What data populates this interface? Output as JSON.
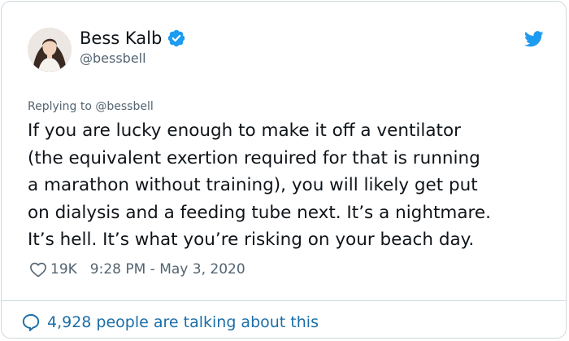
{
  "author": {
    "display_name": "Bess Kalb",
    "handle": "@bessbell",
    "verified": true,
    "avatar_icon": "profile-photo"
  },
  "tweet": {
    "reply_label": "Replying to @bessbell",
    "text_lines": [
      "If you are lucky enough to make it off a ventilator",
      "(the equivalent exertion required for that is running",
      "a marathon without training), you will likely get put",
      "on dialysis and a feeding tube next. It’s a nightmare.",
      "It’s hell. It’s what you’re risking on your beach day."
    ],
    "likes": "19K",
    "timestamp": "9:28 PM - May 3, 2020"
  },
  "footer": {
    "talking_label": "4,928 people are talking about this"
  },
  "icons": {
    "verified": "verified-badge-icon",
    "brand": "twitter-bird-icon",
    "like": "heart-icon",
    "conversation": "speech-bubble-icon"
  },
  "colors": {
    "brand_blue": "#1d9bf0",
    "link_blue": "#1b6ea8",
    "text": "#0f1419",
    "secondary": "#536471",
    "border": "#cfd9de"
  }
}
